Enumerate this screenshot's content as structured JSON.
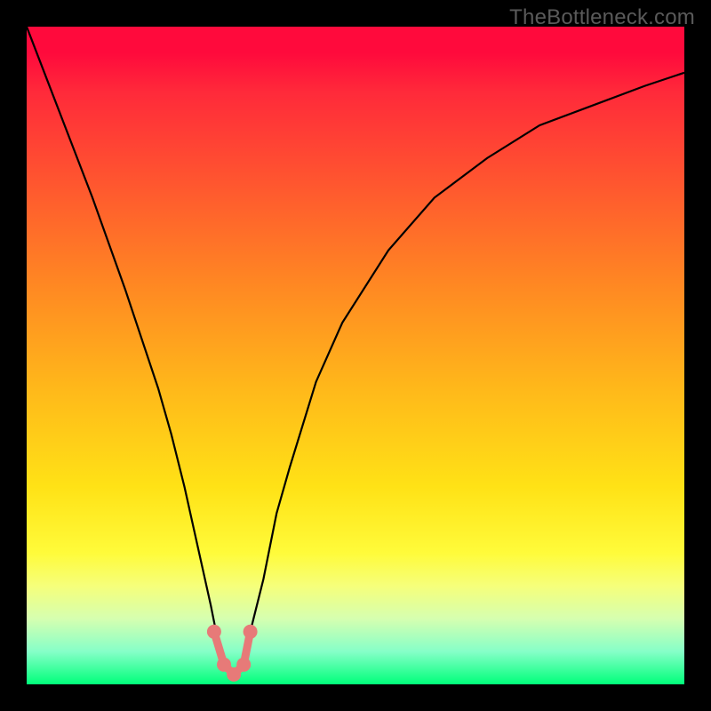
{
  "watermark": "TheBottleneck.com",
  "chart_data": {
    "type": "line",
    "title": "",
    "xlabel": "",
    "ylabel": "",
    "xlim": [
      0,
      100
    ],
    "ylim": [
      0,
      100
    ],
    "grid": false,
    "legend": false,
    "background_gradient": {
      "stops": [
        {
          "pos": 0,
          "color": "#ff0a3c"
        },
        {
          "pos": 25,
          "color": "#ff5a2e"
        },
        {
          "pos": 55,
          "color": "#ffb81a"
        },
        {
          "pos": 80,
          "color": "#fffb3a"
        },
        {
          "pos": 95,
          "color": "#86ffc8"
        },
        {
          "pos": 100,
          "color": "#00ff7a"
        }
      ]
    },
    "series": [
      {
        "name": "bottleneck-curve",
        "x": [
          0,
          5,
          10,
          15,
          20,
          22,
          24,
          26,
          28,
          29,
          30,
          31,
          32,
          33,
          34,
          36,
          38,
          40,
          44,
          48,
          55,
          62,
          70,
          78,
          86,
          94,
          100
        ],
        "y": [
          100,
          87,
          74,
          60,
          45,
          38,
          30,
          21,
          12,
          7,
          3,
          1,
          1,
          3,
          8,
          16,
          26,
          33,
          46,
          55,
          66,
          74,
          80,
          85,
          88,
          91,
          93
        ]
      }
    ],
    "highlight_points": {
      "x": [
        28.5,
        30.0,
        31.5,
        33.0,
        34.0
      ],
      "y": [
        8.0,
        3.0,
        1.5,
        3.0,
        8.0
      ],
      "color": "#e77a78"
    }
  }
}
